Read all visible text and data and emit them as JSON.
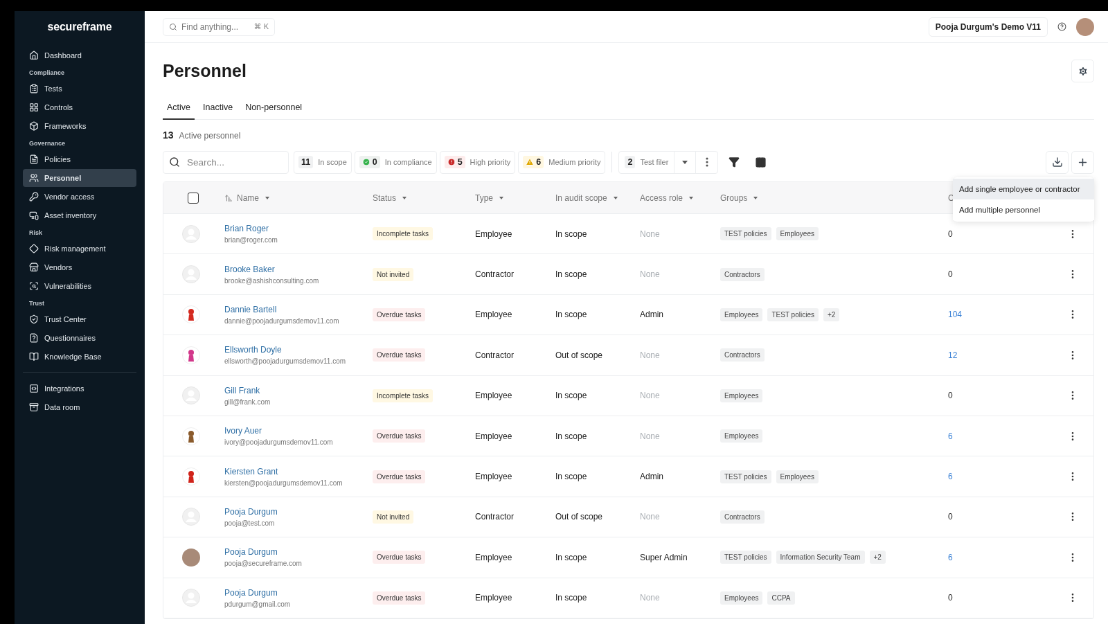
{
  "sidebar": {
    "logo": "secureframe",
    "sections": [
      {
        "items": [
          {
            "label": "Dashboard",
            "selected": false
          }
        ]
      },
      {
        "heading": "Compliance",
        "items": [
          {
            "label": "Tests",
            "selected": false
          },
          {
            "label": "Controls",
            "selected": false
          },
          {
            "label": "Frameworks",
            "selected": false
          }
        ]
      },
      {
        "heading": "Governance",
        "items": [
          {
            "label": "Policies",
            "selected": false
          },
          {
            "label": "Personnel",
            "selected": true
          },
          {
            "label": "Vendor access",
            "selected": false
          },
          {
            "label": "Asset inventory",
            "selected": false
          }
        ]
      },
      {
        "heading": "Risk",
        "items": [
          {
            "label": "Risk management",
            "selected": false
          },
          {
            "label": "Vendors",
            "selected": false
          },
          {
            "label": "Vulnerabilities",
            "selected": false
          }
        ]
      },
      {
        "heading": "Trust",
        "items": [
          {
            "label": "Trust Center",
            "selected": false
          },
          {
            "label": "Questionnaires",
            "selected": false
          },
          {
            "label": "Knowledge Base",
            "selected": false
          }
        ]
      },
      {
        "divider": true,
        "items": [
          {
            "label": "Integrations",
            "selected": false
          },
          {
            "label": "Data room",
            "selected": false
          }
        ]
      }
    ]
  },
  "topbar": {
    "search": {
      "placeholder": "Find anything...",
      "shortcut": "⌘ K"
    },
    "workspace": "Pooja Durgum's Demo V11"
  },
  "page": {
    "title": "Personnel",
    "tabs": [
      {
        "label": "Active",
        "selected": true
      },
      {
        "label": "Inactive",
        "selected": false
      },
      {
        "label": "Non-personnel",
        "selected": false
      }
    ],
    "count": "13",
    "count_label": "Active personnel"
  },
  "toolbar": {
    "search": {
      "placeholder": "Search..."
    },
    "chips": [
      {
        "kind": "plain",
        "count": "11",
        "label": "In scope"
      },
      {
        "kind": "success",
        "count": "0",
        "label": "In compliance"
      },
      {
        "kind": "danger",
        "count": "5",
        "label": "High priority"
      },
      {
        "kind": "warning",
        "count": "6",
        "label": "Medium priority"
      }
    ],
    "saved_filter": {
      "count": "2",
      "label": "Test filer"
    }
  },
  "add_menu": {
    "items": [
      {
        "label": "Add single employee or contractor",
        "selected": true
      },
      {
        "label": "Add multiple personnel",
        "selected": false
      }
    ]
  },
  "table": {
    "select_all": {
      "checked": false
    },
    "columns": [
      {
        "label": "Name",
        "sortable": true
      },
      {
        "label": "Status",
        "sortable": true
      },
      {
        "label": "Type",
        "sortable": true
      },
      {
        "label": "In audit scope",
        "sortable": true
      },
      {
        "label": "Access role",
        "sortable": true
      },
      {
        "label": "Groups",
        "sortable": true
      },
      {
        "label": "C"
      }
    ],
    "rows": [
      {
        "avatar": {
          "kind": "default"
        },
        "name": "Brian Roger",
        "email": "brian@roger.com",
        "status": {
          "label": "Incomplete tasks",
          "kind": "warning"
        },
        "type": "Employee",
        "audit_scope": "In scope",
        "access_role": {
          "label": "None",
          "muted": true
        },
        "groups": [
          "TEST policies",
          "Employees"
        ],
        "count": {
          "label": "0",
          "link": false
        }
      },
      {
        "avatar": {
          "kind": "default"
        },
        "name": "Brooke Baker",
        "email": "brooke@ashishconsulting.com",
        "status": {
          "label": "Not invited",
          "kind": "warning"
        },
        "type": "Contractor",
        "audit_scope": "In scope",
        "access_role": {
          "label": "None",
          "muted": true
        },
        "groups": [
          "Contractors"
        ],
        "count": {
          "label": "0",
          "link": false
        }
      },
      {
        "avatar": {
          "kind": "character",
          "color": "#d42a20"
        },
        "name": "Dannie Bartell",
        "email": "dannie@poojadurgumsdemov11.com",
        "status": {
          "label": "Overdue tasks",
          "kind": "danger"
        },
        "type": "Employee",
        "audit_scope": "In scope",
        "access_role": {
          "label": "Admin",
          "muted": false
        },
        "groups": [
          "Employees",
          "TEST policies",
          "+2"
        ],
        "count": {
          "label": "104",
          "link": true
        }
      },
      {
        "avatar": {
          "kind": "character",
          "color": "#d2378a"
        },
        "name": "Ellsworth Doyle",
        "email": "ellsworth@poojadurgumsdemov11.com",
        "status": {
          "label": "Overdue tasks",
          "kind": "danger"
        },
        "type": "Contractor",
        "audit_scope": "Out of scope",
        "access_role": {
          "label": "None",
          "muted": true
        },
        "groups": [
          "Contractors"
        ],
        "count": {
          "label": "12",
          "link": true
        }
      },
      {
        "avatar": {
          "kind": "default"
        },
        "name": "Gill Frank",
        "email": "gill@frank.com",
        "status": {
          "label": "Incomplete tasks",
          "kind": "warning"
        },
        "type": "Employee",
        "audit_scope": "In scope",
        "access_role": {
          "label": "None",
          "muted": true
        },
        "groups": [
          "Employees"
        ],
        "count": {
          "label": "0",
          "link": false
        }
      },
      {
        "avatar": {
          "kind": "character",
          "color": "#8a5a2b"
        },
        "name": "Ivory Auer",
        "email": "ivory@poojadurgumsdemov11.com",
        "status": {
          "label": "Overdue tasks",
          "kind": "danger"
        },
        "type": "Employee",
        "audit_scope": "In scope",
        "access_role": {
          "label": "None",
          "muted": true
        },
        "groups": [
          "Employees"
        ],
        "count": {
          "label": "6",
          "link": true
        }
      },
      {
        "avatar": {
          "kind": "character",
          "color": "#d0231a"
        },
        "name": "Kiersten Grant",
        "email": "kiersten@poojadurgumsdemov11.com",
        "status": {
          "label": "Overdue tasks",
          "kind": "danger"
        },
        "type": "Employee",
        "audit_scope": "In scope",
        "access_role": {
          "label": "Admin",
          "muted": false
        },
        "groups": [
          "TEST policies",
          "Employees"
        ],
        "count": {
          "label": "6",
          "link": true
        }
      },
      {
        "avatar": {
          "kind": "default"
        },
        "name": "Pooja Durgum",
        "email": "pooja@test.com",
        "status": {
          "label": "Not invited",
          "kind": "warning"
        },
        "type": "Contractor",
        "audit_scope": "Out of scope",
        "access_role": {
          "label": "None",
          "muted": true
        },
        "groups": [
          "Contractors"
        ],
        "count": {
          "label": "0",
          "link": false
        }
      },
      {
        "avatar": {
          "kind": "photo"
        },
        "name": "Pooja Durgum",
        "email": "pooja@secureframe.com",
        "status": {
          "label": "Overdue tasks",
          "kind": "danger"
        },
        "type": "Employee",
        "audit_scope": "In scope",
        "access_role": {
          "label": "Super Admin",
          "muted": false
        },
        "groups": [
          "TEST policies",
          "Information Security Team",
          "+2"
        ],
        "count": {
          "label": "6",
          "link": true
        }
      },
      {
        "avatar": {
          "kind": "default"
        },
        "name": "Pooja Durgum",
        "email": "pdurgum@gmail.com",
        "status": {
          "label": "Overdue tasks",
          "kind": "danger"
        },
        "type": "Employee",
        "audit_scope": "In scope",
        "access_role": {
          "label": "None",
          "muted": true
        },
        "groups": [
          "Employees",
          "CCPA"
        ],
        "count": {
          "label": "0",
          "link": false
        }
      }
    ]
  }
}
